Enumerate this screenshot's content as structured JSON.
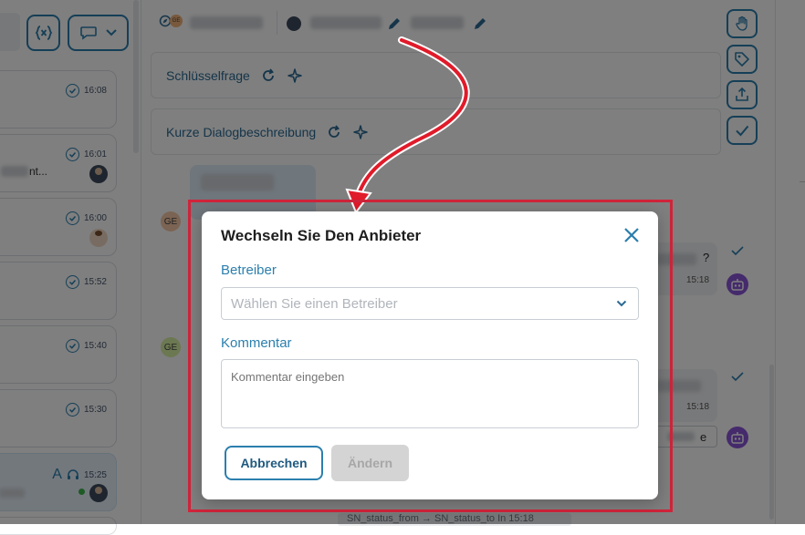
{
  "left_panel": {
    "conversations": [
      {
        "time": "16:08"
      },
      {
        "time": "16:01",
        "preview": "nt..."
      },
      {
        "time": "16:00"
      },
      {
        "time": "15:52"
      },
      {
        "time": "15:40"
      },
      {
        "time": "15:30"
      },
      {
        "time": "15:25",
        "badge": "A"
      }
    ]
  },
  "header": {
    "ge_badge": "GE"
  },
  "cards": {
    "key_question": "Schlüsselfrage",
    "short_description": "Kurze Dialogbeschreibung"
  },
  "chat": {
    "avatar_1": "GE",
    "avatar_2": "GE",
    "msg_1": {
      "end": "?",
      "time": "15:18"
    },
    "msg_2": {
      "time": "15:18"
    },
    "reply_tail": "e",
    "status_line": "SN_status_from → SN_status_to In 15:18"
  },
  "modal": {
    "title": "Wechseln Sie Den Anbieter",
    "operator_label": "Betreiber",
    "operator_placeholder": "Wählen Sie einen Betreiber",
    "comment_label": "Kommentar",
    "comment_placeholder": "Kommentar eingeben",
    "cancel_label": "Abbrechen",
    "change_label": "Ändern"
  },
  "colors": {
    "accent": "#2b7fae",
    "highlight_border": "#d0243a",
    "arrow": "#e01b2a",
    "robot": "#8a55d8"
  }
}
